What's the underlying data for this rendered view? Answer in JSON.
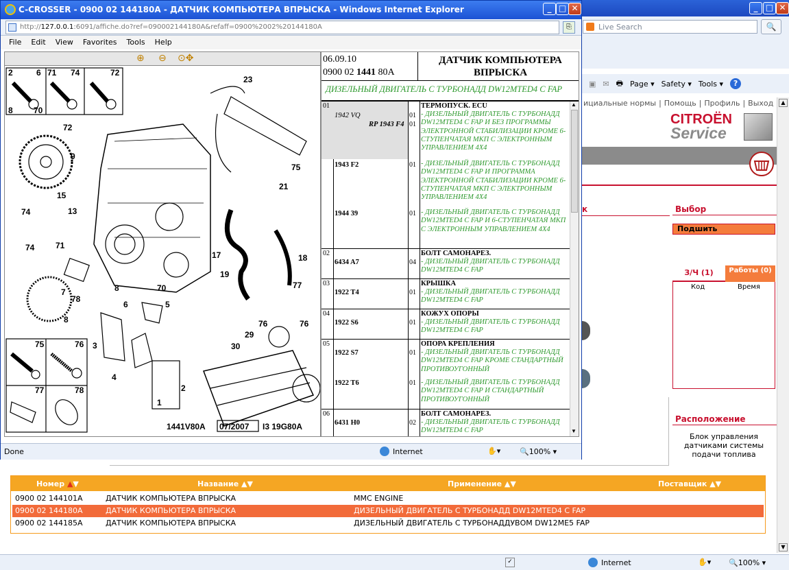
{
  "bg_window": {
    "search_placeholder": "Live Search",
    "commandbar": [
      "Page ▾",
      "Safety ▾",
      "Tools ▾"
    ],
    "toplinks": [
      "ициальные нормы",
      "|",
      "Помощь",
      "|",
      "Профиль",
      "|",
      "Выход"
    ],
    "logo_top": "CITROËN",
    "logo_bottom": "Service",
    "left_tab_fragment": "к",
    "vybor": "Выбор",
    "podshit": "Подшить",
    "tab_parts": "З/Ч (1)",
    "tab_work": "Работы (0)",
    "col_kod": "Код",
    "col_vremya": "Время",
    "raspol_title": "Расположение",
    "raspol_text": "Блок управления датчиками системы подачи топлива",
    "status_zone": "Internet",
    "status_zoom": "100%"
  },
  "table": {
    "headers": {
      "nomer": "Номер",
      "nazvanie": "Название",
      "primenenie": "Применение",
      "postavshik": "Поставщик"
    },
    "rows": [
      {
        "nomer": "0900 02 144101A",
        "nazvanie": "ДАТЧИК КОМПЬЮТЕРА ВПРЫСКА",
        "primenenie": "MMC ENGINE",
        "selected": false
      },
      {
        "nomer": "0900 02 144180A",
        "nazvanie": "ДАТЧИК КОМПЬЮТЕРА ВПРЫСКА",
        "primenenie": "ДИЗЕЛЬНЫЙ ДВИГАТЕЛЬ С ТУРБОНАДД DW12MTED4 C FAP",
        "selected": true
      },
      {
        "nomer": "0900 02 144185A",
        "nazvanie": "ДАТЧИК КОМПЬЮТЕРА ВПРЫСКА",
        "primenenie": "ДИЗЕЛЬНЫЙ ДВИГАТЕЛЬ С ТУРБОНАДДУВОМ DW12ME5 FAP",
        "selected": false
      }
    ]
  },
  "popup": {
    "title": "C-CROSSER - 0900 02 144180A - ДАТЧИК КОМПЬЮТЕРА ВПРЫСКА - Windows Internet Explorer",
    "address_prefix": "http://",
    "address_host": "127.0.0.1",
    "address_rest": ":6091/affiche.do?ref=090002144180A&refaff=0900%2002%20144180A",
    "menu": [
      "File",
      "Edit",
      "View",
      "Favorites",
      "Tools",
      "Help"
    ],
    "status_left": "Done",
    "status_zone": "Internet",
    "status_zoom": "100%"
  },
  "diagram": {
    "footer_code1": "1441V80A",
    "footer_date": "07/2007",
    "footer_code2": "I3 19G80A",
    "labels": [
      "2",
      "6",
      "71",
      "74",
      "72",
      "8",
      "70",
      "23",
      "72",
      "9",
      "75",
      "21",
      "15",
      "74",
      "13",
      "74",
      "71",
      "17",
      "18",
      "19",
      "77",
      "7",
      "78",
      "8",
      "70",
      "6",
      "5",
      "8",
      "3",
      "4",
      "76",
      "76",
      "29",
      "30",
      "2",
      "1",
      "75",
      "76",
      "77",
      "78"
    ]
  },
  "parts_panel": {
    "date": "06.09.10",
    "code_prefix": "0900 02 ",
    "code_bold": "1441",
    "code_suffix": " 80A",
    "title": "ДАТЧИК КОМПЬЮТЕРА ВПРЫСКА",
    "subtitle": "ДИЗЕЛЬНЫЙ ДВИГАТЕЛЬ С ТУРБОНАДД DW12MTED4 C FAP",
    "sections": [
      {
        "num": "01",
        "name": "ТЕРМОПУСК. ECU",
        "items": [
          {
            "ref": "1942 VQ",
            "qty": "01",
            "text": "- ДИЗЕЛЬНЫЙ ДВИГАТЕЛЬ С ТУРБОНАДД"
          },
          {
            "ref": "RP 1943 F4",
            "qty": "01",
            "text": "DW12MTED4 C FAP И БЕЗ ПРОГРАММЫ ЭЛЕКТРОННОЙ СТАБИЛИЗАЦИИ КРОМЕ 6-СТУПЕНЧАТАЯ МКП С ЭЛЕКТРОННЫМ УПРАВЛЕНИЕМ 4X4"
          },
          {
            "ref": "1943 F2",
            "qty": "01",
            "text": "- ДИЗЕЛЬНЫЙ ДВИГАТЕЛЬ С ТУРБОНАДД DW12MTED4 C FAP И ПРОГРАММА ЭЛЕКТРОННОЙ СТАБИЛИЗАЦИИ КРОМЕ 6-СТУПЕНЧАТАЯ МКП С ЭЛЕКТРОННЫМ УПРАВЛЕНИЕМ 4X4"
          },
          {
            "ref": "1944 39",
            "qty": "01",
            "text": "- ДИЗЕЛЬНЫЙ ДВИГАТЕЛЬ С ТУРБОНАДД DW12MTED4 C FAP И 6-СТУПЕНЧАТАЯ МКП С ЭЛЕКТРОННЫМ УПРАВЛЕНИЕМ 4X4"
          }
        ]
      },
      {
        "num": "02",
        "name": "БОЛТ САМОНАРЕЗ.",
        "items": [
          {
            "ref": "6434 A7",
            "qty": "04",
            "text": "- ДИЗЕЛЬНЫЙ ДВИГАТЕЛЬ С ТУРБОНАДД DW12MTED4 C FAP"
          }
        ]
      },
      {
        "num": "03",
        "name": "КРЫШКА",
        "items": [
          {
            "ref": "1922 T4",
            "qty": "01",
            "text": "- ДИЗЕЛЬНЫЙ ДВИГАТЕЛЬ С ТУРБОНАДД DW12MTED4 C FAP"
          }
        ]
      },
      {
        "num": "04",
        "name": "КОЖУХ ОПОРЫ",
        "items": [
          {
            "ref": "1922 S6",
            "qty": "01",
            "text": "- ДИЗЕЛЬНЫЙ ДВИГАТЕЛЬ С ТУРБОНАДД DW12MTED4 C FAP"
          }
        ]
      },
      {
        "num": "05",
        "name": "ОПОРА КРЕПЛЕНИЯ",
        "items": [
          {
            "ref": "1922 S7",
            "qty": "01",
            "text": "- ДИЗЕЛЬНЫЙ ДВИГАТЕЛЬ С ТУРБОНАДД DW12MTED4 C FAP КРОМЕ СТАНДАРТНЫЙ ПРОТИВОУГОННЫЙ"
          },
          {
            "ref": "1922 T6",
            "qty": "01",
            "text": "- ДИЗЕЛЬНЫЙ ДВИГАТЕЛЬ С ТУРБОНАДД DW12MTED4 C FAP И СТАНДАРТНЫЙ ПРОТИВОУГОННЫЙ"
          }
        ]
      },
      {
        "num": "06",
        "name": "БОЛТ САМОНАРЕЗ.",
        "items": [
          {
            "ref": "6431 H0",
            "qty": "02",
            "text": "- ДИЗЕЛЬНЫЙ ДВИГАТЕЛЬ С ТУРБОНАДД DW12MTED4 C FAP"
          }
        ]
      }
    ]
  }
}
